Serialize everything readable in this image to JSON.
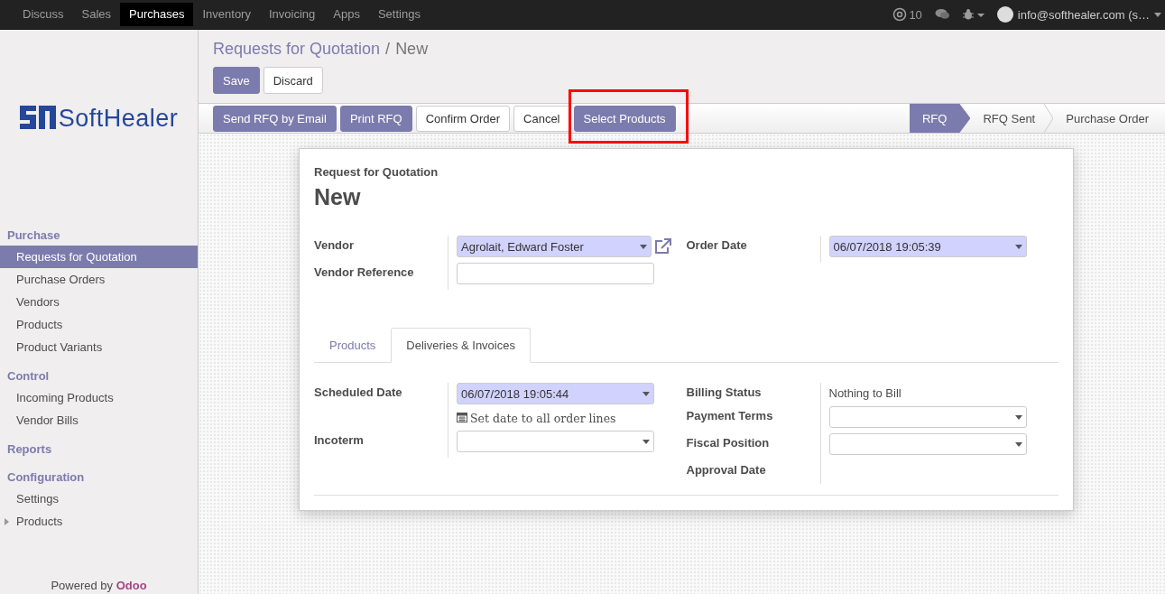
{
  "navbar": {
    "apps": [
      {
        "label": "Discuss",
        "selected": false
      },
      {
        "label": "Sales",
        "selected": false
      },
      {
        "label": "Purchases",
        "selected": true
      },
      {
        "label": "Inventory",
        "selected": false
      },
      {
        "label": "Invoicing",
        "selected": false
      },
      {
        "label": "Apps",
        "selected": false
      },
      {
        "label": "Settings",
        "selected": false
      }
    ],
    "mentions": "10",
    "user": "info@softhealer.com (s…"
  },
  "sidebar": {
    "logo": "SoftHealer",
    "sections": [
      {
        "title": "Purchase",
        "items": [
          {
            "label": "Requests for Quotation",
            "selected": true,
            "kind": "link"
          },
          {
            "label": "Purchase Orders",
            "selected": false,
            "kind": "link"
          },
          {
            "label": "Vendors",
            "selected": false,
            "kind": "link"
          },
          {
            "label": "Products",
            "selected": false,
            "kind": "link"
          },
          {
            "label": "Product Variants",
            "selected": false,
            "kind": "link"
          }
        ]
      },
      {
        "title": "Control",
        "items": [
          {
            "label": "Incoming Products",
            "selected": false,
            "kind": "link"
          },
          {
            "label": "Vendor Bills",
            "selected": false,
            "kind": "link"
          }
        ]
      },
      {
        "title": "Reports"
      },
      {
        "title": "Configuration",
        "items": [
          {
            "label": "Settings",
            "selected": false,
            "kind": "link"
          },
          {
            "label": "Products",
            "selected": false,
            "kind": "folder"
          }
        ]
      }
    ],
    "footer": "Powered by **Odoo**"
  },
  "breadcrumb": {
    "parent": "Requests for Quotation",
    "separator": "/",
    "current": "New"
  },
  "main_buttons": [
    {
      "label": "Save",
      "primary": true
    },
    {
      "label": "Discard",
      "primary": false
    }
  ],
  "header_buttons": [
    {
      "label": "Send RFQ by Email",
      "primary": true,
      "highlighted": false
    },
    {
      "label": "Print RFQ",
      "primary": true,
      "highlighted": false
    },
    {
      "label": "Confirm Order",
      "primary": false,
      "highlighted": false
    },
    {
      "label": "Cancel",
      "primary": false,
      "highlighted": false
    },
    {
      "label": "Select Products",
      "primary": true,
      "highlighted": true
    }
  ],
  "status_steps": [
    {
      "label": "RFQ",
      "selected": true
    },
    {
      "label": "RFQ Sent",
      "selected": false
    },
    {
      "label": "Purchase Order",
      "selected": false
    }
  ],
  "form": {
    "subtitle": "Request for Quotation",
    "title": "New",
    "left_fields": [
      {
        "label": "Vendor",
        "kind": "select",
        "value": "Agrolait, Edward Foster",
        "required": true,
        "external_link": true
      },
      {
        "label": "Vendor Reference",
        "kind": "input",
        "required": false
      }
    ],
    "right_fields": [
      {
        "label": "Order Date",
        "kind": "select",
        "value": "06/07/2018 19:05:39",
        "required": true
      }
    ],
    "tabs": [
      {
        "label": "Products",
        "selected": false
      },
      {
        "label": "Deliveries & Invoices",
        "selected": true
      }
    ],
    "tab_left": [
      {
        "label": "Scheduled Date",
        "kind": "select",
        "value": "06/07/2018 19:05:44",
        "required": true,
        "note": "Set date to all order lines"
      },
      {
        "label": "Incoterm",
        "kind": "select",
        "required": false
      }
    ],
    "tab_right": [
      {
        "label": "Billing Status",
        "kind": "text",
        "value": "Nothing to Bill"
      },
      {
        "label": "Payment Terms",
        "kind": "select",
        "required": false
      },
      {
        "label": "Fiscal Position",
        "kind": "select",
        "required": false
      },
      {
        "label": "Approval Date",
        "kind": "text"
      }
    ]
  }
}
